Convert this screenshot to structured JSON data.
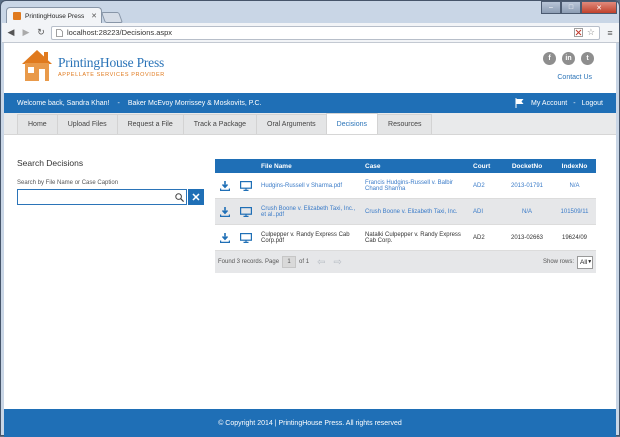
{
  "browser": {
    "tab_title": "PrintingHouse Press",
    "url": "localhost:28223/Decisions.aspx",
    "window_buttons": {
      "minimize": "–",
      "maximize": "□",
      "close": "✕"
    }
  },
  "header": {
    "logo_name_part1": "Printing",
    "logo_name_part2": "House Press",
    "logo_subtitle": "APPELLATE SERVICES PROVIDER",
    "social": [
      "f",
      "in",
      "t"
    ],
    "contact_label": "Contact Us"
  },
  "userbar": {
    "welcome": "Welcome back, Sandra Khan!",
    "separator": "-",
    "firm": "Baker McEvoy Morrissey & Moskovits, P.C.",
    "my_account": "My Account",
    "separator2": "-",
    "logout": "Logout"
  },
  "nav": {
    "items": [
      "Home",
      "Upload Files",
      "Request a File",
      "Track a Package",
      "Oral Arguments",
      "Decisions",
      "Resources"
    ],
    "active_index": 5
  },
  "search": {
    "title": "Search Decisions",
    "label": "Search by File Name or Case Caption",
    "value": "",
    "clear_icon": "✕"
  },
  "grid": {
    "columns": [
      "",
      "",
      "File Name",
      "Case",
      "Court",
      "DocketNo",
      "IndexNo"
    ],
    "rows": [
      {
        "file": "Hudgins-Russell v Sharma.pdf",
        "case": "Francis Hudgins-Russell v. Balbir Chand Sharma",
        "court": "AD2",
        "docket": "2013-01791",
        "index": "N/A",
        "linked": true
      },
      {
        "file": "Crush Boone v. Elizabeth Taxi, Inc., et al..pdf",
        "case": "Crush Boone v. Elizabeth Taxi, Inc.",
        "court": "ADI",
        "docket": "N/A",
        "index": "101509/11",
        "linked": true
      },
      {
        "file": "Culpepper v. Randy Express Cab Corp.pdf",
        "case": "Natalki Culpepper v. Randy Express Cab Corp.",
        "court": "AD2",
        "docket": "2013-02663",
        "index": "19624/09",
        "linked": false
      }
    ],
    "pager": {
      "found": "Found 3 records. Page",
      "page": "1",
      "of": "of 1",
      "prev": "⇦",
      "next": "⇨",
      "show_rows_label": "Show rows:",
      "show_rows_value": "All"
    }
  },
  "footer": {
    "text": "© Copyright 2014 | PrintingHouse Press. All rights reserved"
  },
  "colors": {
    "brand_blue": "#1f6fb6",
    "accent_orange": "#e07a1e"
  }
}
